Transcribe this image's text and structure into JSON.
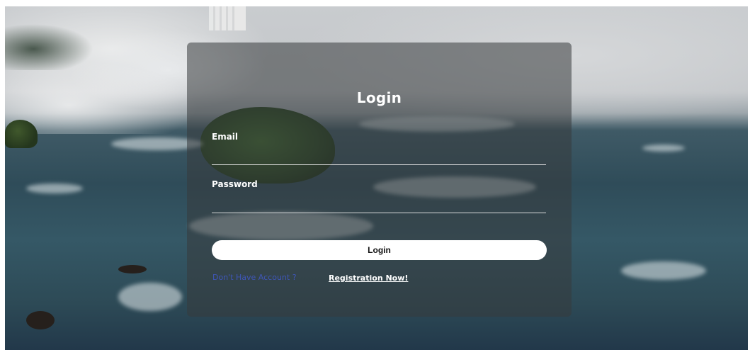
{
  "login": {
    "title": "Login",
    "email_label": "Email",
    "email_value": "",
    "password_label": "Password",
    "password_value": "",
    "button_label": "Login",
    "no_account_text": "Don't Have Account ?",
    "register_link": "Registration Now!"
  },
  "colors": {
    "card_background": "#373a3c",
    "button_background": "#ffffff",
    "no_account_text": "#3f56b8",
    "text": "#ffffff"
  }
}
